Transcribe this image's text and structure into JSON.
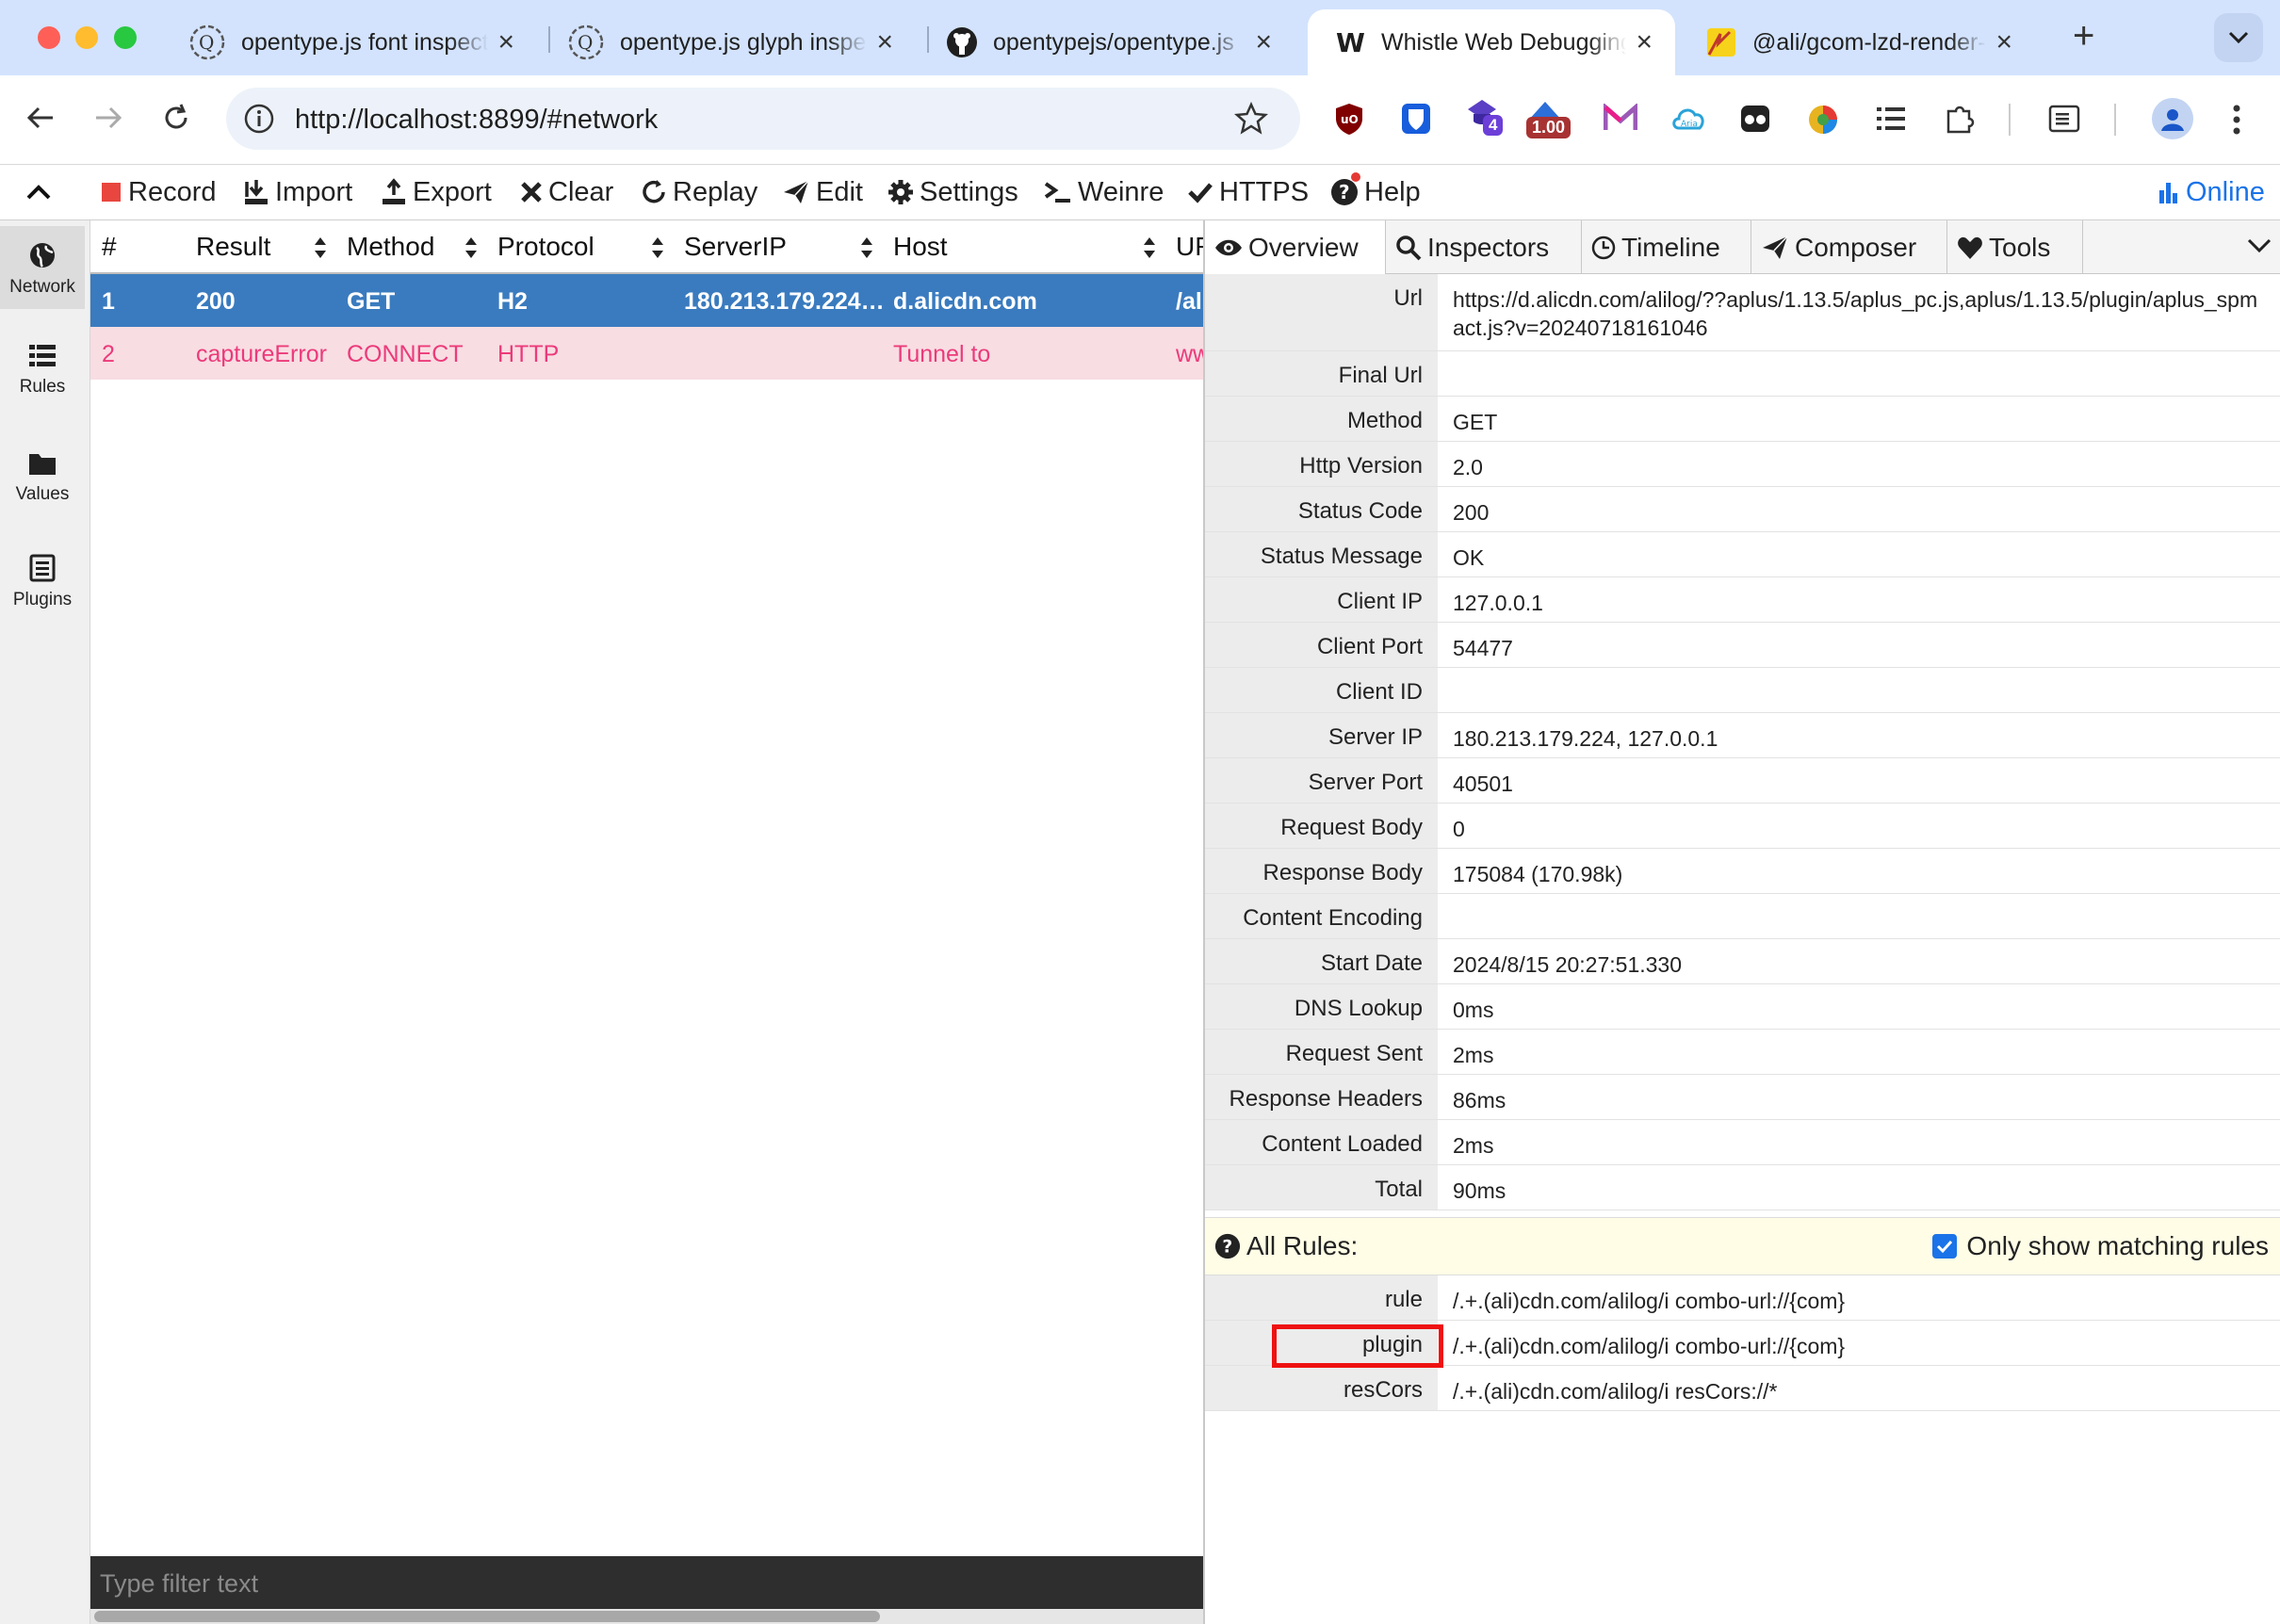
{
  "browser": {
    "tabs": [
      {
        "title": "opentype.js font inspector",
        "icon": "opentype-icon",
        "active": false
      },
      {
        "title": "opentype.js glyph inspector",
        "icon": "opentype-icon",
        "active": false
      },
      {
        "title": "opentypejs/opentype.js",
        "icon": "github-icon",
        "active": false
      },
      {
        "title": "Whistle Web Debugging Proxy",
        "icon": "whistle-icon",
        "active": true
      },
      {
        "title": "@ali/gcom-lzd-render-",
        "icon": "pikachu-icon",
        "active": false
      }
    ],
    "new_tab": "+",
    "url": "http://localhost:8899/#network",
    "extensions": {
      "badge_purple": "4",
      "badge_red": "1.00"
    }
  },
  "menu": {
    "collapse": "",
    "record": "Record",
    "import": "Import",
    "export": "Export",
    "clear": "Clear",
    "replay": "Replay",
    "edit": "Edit",
    "settings": "Settings",
    "weinre": "Weinre",
    "https": "HTTPS",
    "help": "Help",
    "online": "Online"
  },
  "sidebar": [
    {
      "label": "Network",
      "icon": "globe-icon",
      "active": true
    },
    {
      "label": "Rules",
      "icon": "list-icon",
      "active": false
    },
    {
      "label": "Values",
      "icon": "folder-icon",
      "active": false
    },
    {
      "label": "Plugins",
      "icon": "plugin-icon",
      "active": false
    }
  ],
  "network": {
    "columns": [
      "#",
      "Result",
      "Method",
      "Protocol",
      "ServerIP",
      "Host",
      "UR"
    ],
    "rows": [
      {
        "num": "1",
        "result": "200",
        "method": "GET",
        "protocol": "H2",
        "serverip": "180.213.179.224…",
        "host": "d.alicdn.com",
        "url": "/al"
      },
      {
        "num": "2",
        "result": "captureError",
        "method": "CONNECT",
        "protocol": "HTTP",
        "serverip": "",
        "host": "Tunnel to",
        "url": "ww"
      }
    ],
    "filter_placeholder": "Type filter text"
  },
  "detail": {
    "tabs": [
      "Overview",
      "Inspectors",
      "Timeline",
      "Composer",
      "Tools"
    ],
    "fields": [
      {
        "key": "Url",
        "value": "https://d.alicdn.com/alilog/??aplus/1.13.5/aplus_pc.js,aplus/1.13.5/plugin/aplus_spmact.js?v=20240718161046"
      },
      {
        "key": "Final Url",
        "value": ""
      },
      {
        "key": "Method",
        "value": "GET"
      },
      {
        "key": "Http Version",
        "value": "2.0"
      },
      {
        "key": "Status Code",
        "value": "200"
      },
      {
        "key": "Status Message",
        "value": "OK"
      },
      {
        "key": "Client IP",
        "value": "127.0.0.1"
      },
      {
        "key": "Client Port",
        "value": "54477"
      },
      {
        "key": "Client ID",
        "value": ""
      },
      {
        "key": "Server IP",
        "value": "180.213.179.224, 127.0.0.1"
      },
      {
        "key": "Server Port",
        "value": "40501"
      },
      {
        "key": "Request Body",
        "value": "0"
      },
      {
        "key": "Response Body",
        "value": "175084 (170.98k)"
      },
      {
        "key": "Content Encoding",
        "value": ""
      },
      {
        "key": "Start Date",
        "value": "2024/8/15 20:27:51.330"
      },
      {
        "key": "DNS Lookup",
        "value": "0ms"
      },
      {
        "key": "Request Sent",
        "value": "2ms"
      },
      {
        "key": "Response Headers",
        "value": "86ms"
      },
      {
        "key": "Content Loaded",
        "value": "2ms"
      },
      {
        "key": "Total",
        "value": "90ms"
      }
    ],
    "rules_title": "All Rules:",
    "only_matching": "Only show matching rules",
    "only_matching_checked": true,
    "rules": [
      {
        "key": "rule",
        "value": "/.+.(ali)cdn.com/alilog/i combo-url://{com}"
      },
      {
        "key": "plugin",
        "value": "/.+.(ali)cdn.com/alilog/i combo-url://{com}",
        "highlighted": true
      },
      {
        "key": "resCors",
        "value": "/.+.(ali)cdn.com/alilog/i resCors://*"
      }
    ]
  },
  "colors": {
    "selected_row": "#3a7bbf",
    "error_row": "#f8dde3",
    "error_text": "#ec3a7a",
    "record_red": "#e8463f",
    "highlight": "#e11111",
    "online": "#1a73e8"
  }
}
